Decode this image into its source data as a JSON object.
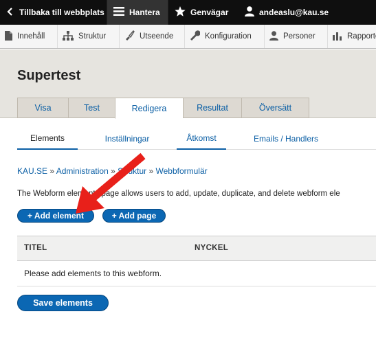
{
  "toolbar": {
    "back_label": "Tillbaka till webbplats",
    "manage_label": "Hantera",
    "shortcuts_label": "Genvägar",
    "user_label": "andeaslu@kau.se"
  },
  "tray": {
    "items": [
      {
        "label": "Innehåll",
        "icon": "document-icon"
      },
      {
        "label": "Struktur",
        "icon": "structure-icon"
      },
      {
        "label": "Utseende",
        "icon": "paintbrush-icon"
      },
      {
        "label": "Konfiguration",
        "icon": "wrench-icon"
      },
      {
        "label": "Personer",
        "icon": "person-icon"
      },
      {
        "label": "Rapporter",
        "icon": "bar-chart-icon"
      }
    ]
  },
  "page": {
    "title": "Supertest",
    "tabs": [
      "Visa",
      "Test",
      "Redigera",
      "Resultat",
      "Översätt"
    ],
    "active_tab": "Redigera",
    "subtabs": [
      "Elements",
      "Inställningar",
      "Åtkomst",
      "Emails / Handlers"
    ],
    "active_subtab": "Elements"
  },
  "breadcrumb": {
    "items": [
      "KAU.SE",
      "Administration",
      "Struktur",
      "Webbformulär"
    ],
    "separator": "»"
  },
  "description": "The Webform elements page allows users to add, update, duplicate, and delete webform ele",
  "buttons": {
    "add_element": "+ Add element",
    "add_page": "+ Add page",
    "save": "Save elements"
  },
  "table": {
    "headers": [
      "TITEL",
      "NYCKEL"
    ],
    "empty_message": "Please add elements to this webform."
  },
  "colors": {
    "toolbar_bg": "#0f0f0f",
    "link": "#0b5fa5",
    "button": "#0b67b3",
    "annotation_arrow": "#e8201a"
  }
}
